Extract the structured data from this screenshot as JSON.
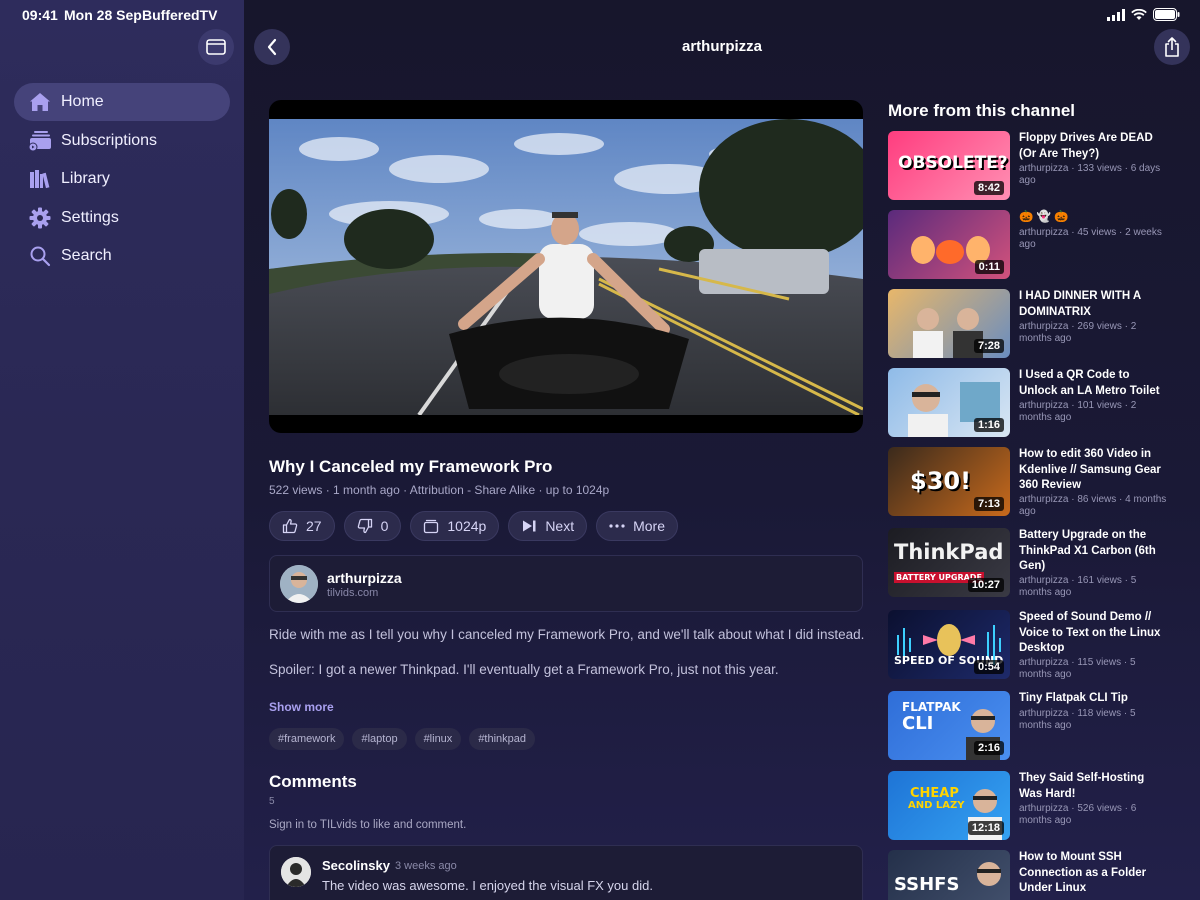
{
  "status_bar": {
    "time": "09:41",
    "date": "Mon 28 Sep",
    "app": "BufferedTV"
  },
  "sidebar": {
    "items": [
      {
        "label": "Home",
        "icon": "home-icon",
        "active": true
      },
      {
        "label": "Subscriptions",
        "icon": "subscriptions-icon",
        "active": false
      },
      {
        "label": "Library",
        "icon": "library-icon",
        "active": false
      },
      {
        "label": "Settings",
        "icon": "gear-icon",
        "active": false
      },
      {
        "label": "Search",
        "icon": "search-icon",
        "active": false
      }
    ]
  },
  "header": {
    "title": "arthurpizza"
  },
  "video": {
    "title": "Why I Canceled my Framework Pro",
    "meta": "522 views · 1 month ago · Attribution - Share Alike · up to 1024p",
    "likes": "27",
    "dislikes": "0",
    "quality": "1024p",
    "next_label": "Next",
    "more_label": "More"
  },
  "channel": {
    "name": "arthurpizza",
    "site": "tilvids.com"
  },
  "description": {
    "line1": "Ride with me as I tell you why I canceled my Framework Pro, and we'll talk about what I did instead.",
    "line2": "Spoiler: I got a newer Thinkpad. I'll eventually get a Framework Pro, just not this year.",
    "show_more": "Show more"
  },
  "tags": [
    "#framework",
    "#laptop",
    "#linux",
    "#thinkpad"
  ],
  "comments": {
    "title": "Comments",
    "count": "5",
    "signin": "Sign in to TILvids to like and comment.",
    "items": [
      {
        "author": "Secolinsky",
        "time": "3 weeks ago",
        "text": "The video was awesome.  I enjoyed the visual FX you did."
      }
    ]
  },
  "related": {
    "title": "More from this channel",
    "items": [
      {
        "title": "Floppy Drives Are DEAD (Or Are They?)",
        "meta": "arthurpizza · 133 views · 6 days ago",
        "duration": "8:42",
        "thumb_text": "OBSOLETE?"
      },
      {
        "title": "🎃 👻 🎃",
        "meta": "arthurpizza · 45 views · 2 weeks ago",
        "duration": "0:11",
        "thumb_text": ""
      },
      {
        "title": "I HAD DINNER WITH A DOMINATRIX",
        "meta": "arthurpizza · 269 views · 2 months ago",
        "duration": "7:28",
        "thumb_text": ""
      },
      {
        "title": "I Used a QR Code to Unlock an LA Metro Toilet",
        "meta": "arthurpizza · 101 views · 2 months ago",
        "duration": "1:16",
        "thumb_text": ""
      },
      {
        "title": "How to edit 360 Video in Kdenlive // Samsung Gear 360 Review",
        "meta": "arthurpizza · 86 views · 4 months ago",
        "duration": "7:13",
        "thumb_text": "$30!"
      },
      {
        "title": "Battery Upgrade on the ThinkPad X1 Carbon (6th Gen)",
        "meta": "arthurpizza · 161 views · 5 months ago",
        "duration": "10:27",
        "thumb_text": "ThinkPad",
        "thumb_text2": "BATTERY UPGRADE"
      },
      {
        "title": "Speed of Sound Demo // Voice to Text on the Linux Desktop",
        "meta": "arthurpizza · 115 views · 5 months ago",
        "duration": "0:54",
        "thumb_text": "SPEED OF SOUND"
      },
      {
        "title": "Tiny Flatpak CLI Tip",
        "meta": "arthurpizza · 118 views · 5 months ago",
        "duration": "2:16",
        "thumb_text": "FLATPAK",
        "thumb_text2": "CLI"
      },
      {
        "title": "They Said Self-Hosting Was Hard!",
        "meta": "arthurpizza · 526 views · 6 months ago",
        "duration": "12:18",
        "thumb_text": "CHEAP",
        "thumb_text2": "AND LAZY"
      },
      {
        "title": "How to Mount SSH Connection as a Folder Under Linux",
        "meta": "",
        "duration": "",
        "thumb_text": "SSHFS"
      }
    ]
  },
  "colors": {
    "accent": "#a9a0ef",
    "sidebar": "#2e2c5c",
    "background": "#17162c"
  }
}
